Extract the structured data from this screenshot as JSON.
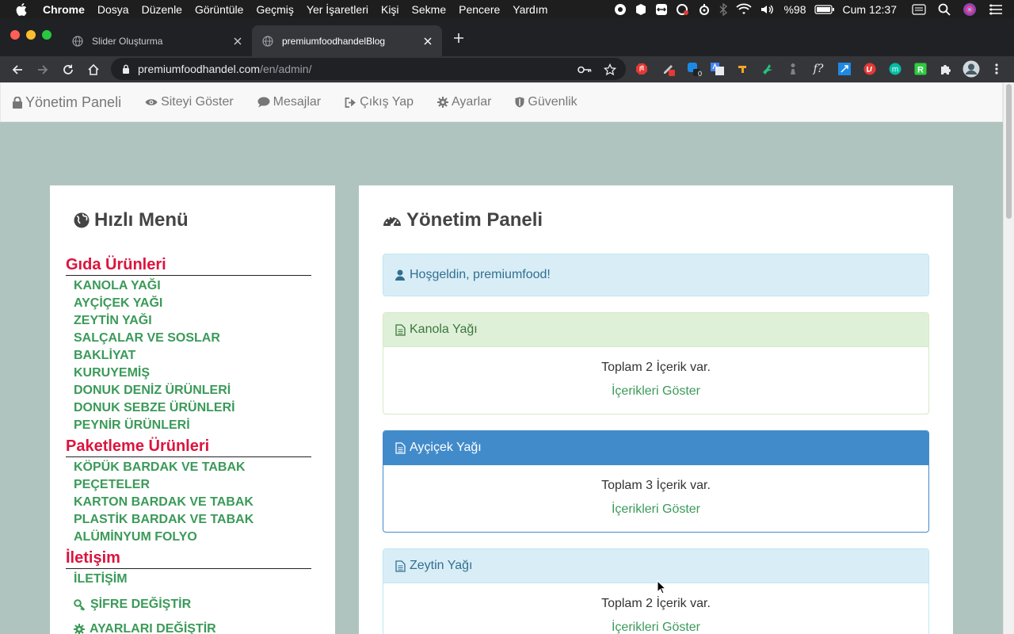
{
  "menubar": {
    "app": "Chrome",
    "items": [
      "Dosya",
      "Düzenle",
      "Görüntüle",
      "Geçmiş",
      "Yer İşaretleri",
      "Kişi",
      "Sekme",
      "Pencere",
      "Yardım"
    ],
    "battery": "%98",
    "clock": "Cum 12:37"
  },
  "tabs": [
    {
      "title": "Slider Oluşturma",
      "active": false
    },
    {
      "title": "premiumfoodhandelBlog",
      "active": true
    }
  ],
  "omnibox": {
    "host": "premiumfoodhandel.com",
    "path": "/en/admin/"
  },
  "extension_badge": "0",
  "navbar": {
    "brand": "Yönetim Paneli",
    "links": [
      "Siteyi Göster",
      "Mesajlar",
      "Çıkış Yap",
      "Ayarlar",
      "Güvenlik"
    ]
  },
  "sidebar": {
    "title": "Hızlı Menü",
    "categories": [
      {
        "name": "Gıda Ürünleri",
        "items": [
          "KANOLA YAĞI",
          "AYÇİÇEK YAĞI",
          "ZEYTİN YAĞI",
          "SALÇALAR VE SOSLAR",
          "BAKLİYAT",
          "KURUYEMİŞ",
          "DONUK DENİZ ÜRÜNLERİ",
          "DONUK SEBZE ÜRÜNLERİ",
          "PEYNİR ÜRÜNLERİ"
        ]
      },
      {
        "name": "Paketleme Ürünleri",
        "items": [
          "KÖPÜK BARDAK VE TABAK",
          "PEÇETELER",
          "KARTON BARDAK VE TABAK",
          "PLASTİK BARDAK VE TABAK",
          "ALÜMİNYUM FOLYO"
        ]
      },
      {
        "name": "İletişim",
        "items": [
          "İLETİŞİM"
        ]
      }
    ],
    "actions": [
      "ŞİFRE DEĞİŞTİR",
      "AYARLARI DEĞİŞTİR"
    ]
  },
  "main": {
    "title": "Yönetim Paneli",
    "welcome": "Hoşgeldin, premiumfood!",
    "cards": [
      {
        "title": "Kanola Yağı",
        "total": "Toplam 2 İçerik var.",
        "link": "İçerikleri Göster",
        "style": "success"
      },
      {
        "title": "Ayçiçek Yağı",
        "total": "Toplam 3 İçerik var.",
        "link": "İçerikleri Göster",
        "style": "primary"
      },
      {
        "title": "Zeytin Yağı",
        "total": "Toplam 2 İçerik var.",
        "link": "İçerikleri Göster",
        "style": "info"
      }
    ]
  },
  "colors": {
    "page_bg": "#b0c4bf",
    "category_red": "#dc143c",
    "link_green": "#3b9a59",
    "primary": "#428bca"
  }
}
